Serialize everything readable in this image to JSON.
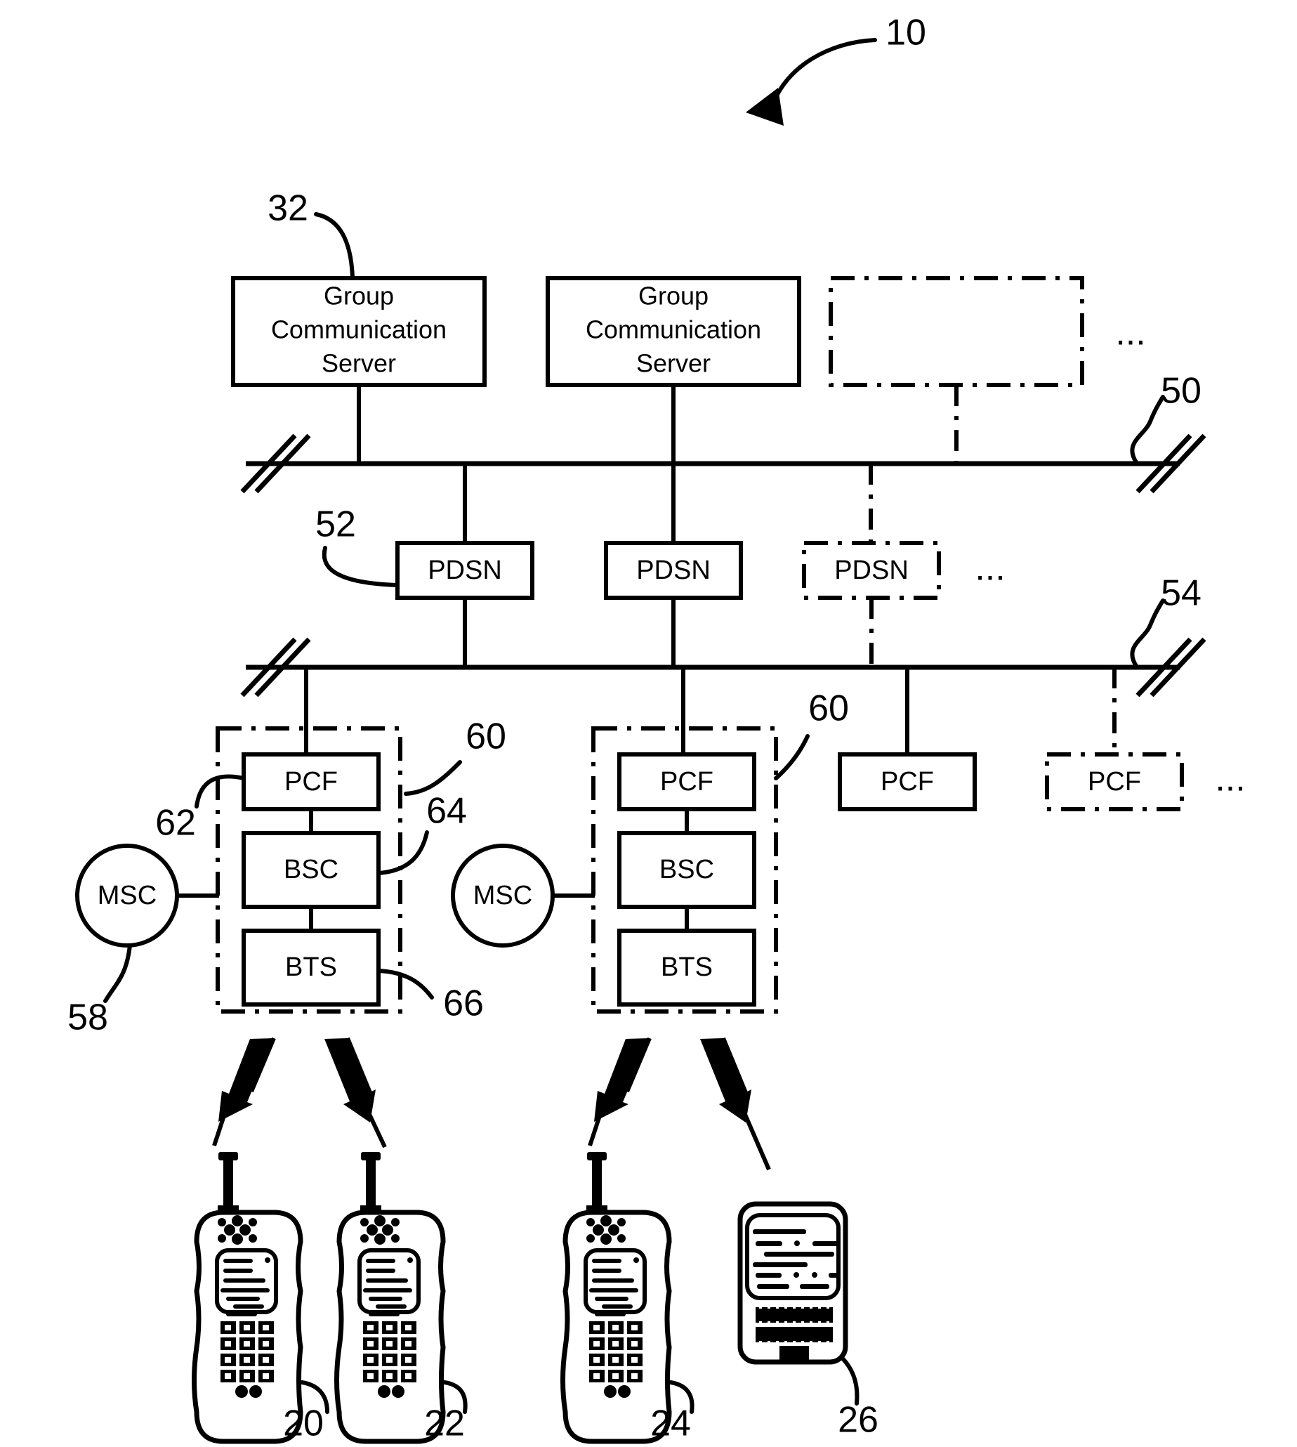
{
  "figure": {
    "reference_numeral": "10",
    "type": "patent-network-diagram"
  },
  "servers": {
    "label_lines": [
      "Group",
      "Communication",
      "Server"
    ],
    "ref": "32",
    "ellipsis": "...",
    "items": [
      {
        "id": "gcs-1",
        "style": "solid"
      },
      {
        "id": "gcs-2",
        "style": "solid"
      },
      {
        "id": "gcs-3",
        "style": "ghost"
      }
    ]
  },
  "bus_top": {
    "ref": "50"
  },
  "bus_bottom": {
    "ref": "54"
  },
  "pdsn": {
    "label": "PDSN",
    "ref": "52",
    "ellipsis": "...",
    "items": [
      {
        "id": "pdsn-1",
        "style": "solid"
      },
      {
        "id": "pdsn-2",
        "style": "solid"
      },
      {
        "id": "pdsn-3",
        "style": "ghost"
      }
    ]
  },
  "access_network": {
    "group_ref_left": "60",
    "group_ref_right": "60",
    "pcf_label": "PCF",
    "bsc_label": "BSC",
    "bts_label": "BTS",
    "pcf_ref": "62",
    "bsc_ref": "64",
    "bts_ref": "66",
    "msc_label": "MSC",
    "msc_ref": "58",
    "ellipsis": "...",
    "extra_pcf": [
      {
        "id": "pcf-3",
        "style": "solid"
      },
      {
        "id": "pcf-4",
        "style": "ghost"
      }
    ]
  },
  "devices": [
    {
      "id": "dev-20",
      "ref": "20",
      "kind": "handset"
    },
    {
      "id": "dev-22",
      "ref": "22",
      "kind": "handset"
    },
    {
      "id": "dev-24",
      "ref": "24",
      "kind": "handset"
    },
    {
      "id": "dev-26",
      "ref": "26",
      "kind": "pda"
    }
  ],
  "colors": {
    "ink": "#000000",
    "paper": "#ffffff"
  }
}
